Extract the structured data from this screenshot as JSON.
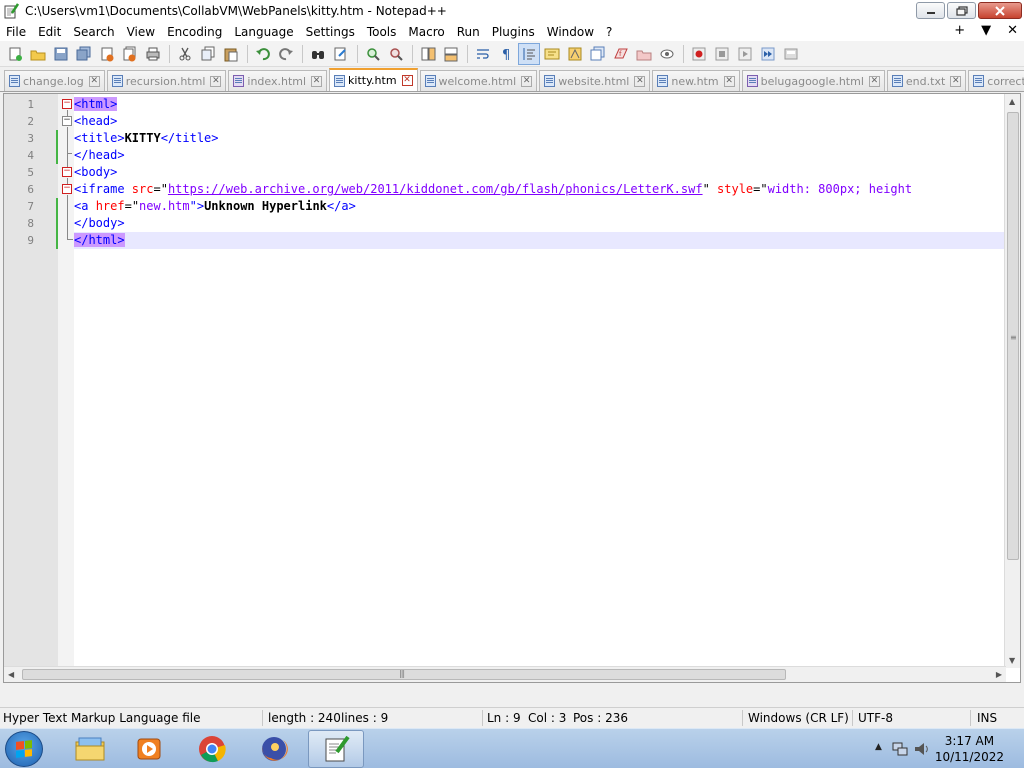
{
  "window": {
    "title": "C:\\Users\\vm1\\Documents\\CollabVM\\WebPanels\\kitty.htm - Notepad++",
    "minimize": "▁",
    "maximize": "❐",
    "close": "✕"
  },
  "menu": {
    "items": [
      "File",
      "Edit",
      "Search",
      "View",
      "Encoding",
      "Language",
      "Settings",
      "Tools",
      "Macro",
      "Run",
      "Plugins",
      "Window",
      "?"
    ],
    "right": [
      "+",
      "▼",
      "✕"
    ]
  },
  "toolbar": {
    "icons": [
      "new-file-icon",
      "open-file-icon",
      "save-icon",
      "save-all-icon",
      "close-icon",
      "close-all-icon",
      "print-icon",
      "cut-icon",
      "copy-icon",
      "paste-icon",
      "undo-icon",
      "redo-icon",
      "find-icon",
      "replace-icon",
      "zoom-in-icon",
      "zoom-out-icon",
      "sync-v-icon",
      "sync-h-icon",
      "word-wrap-icon",
      "show-all-chars-icon",
      "indent-guide-icon",
      "udl-icon",
      "doc-map-icon",
      "function-list-icon",
      "folder-workspace-icon",
      "monitor-icon",
      "record-macro-icon",
      "stop-macro-icon",
      "play-macro-icon",
      "play-multiple-icon",
      "save-macro-icon"
    ]
  },
  "tabs": [
    {
      "label": "change.log",
      "active": false
    },
    {
      "label": "recursion.html",
      "active": false
    },
    {
      "label": "index.html",
      "active": false
    },
    {
      "label": "kitty.htm",
      "active": true
    },
    {
      "label": "welcome.html",
      "active": false
    },
    {
      "label": "website.html",
      "active": false
    },
    {
      "label": "new.htm",
      "active": false
    },
    {
      "label": "belugagoogle.html",
      "active": false
    },
    {
      "label": "end.txt",
      "active": false
    },
    {
      "label": "correct.html",
      "active": false
    }
  ],
  "editor": {
    "line_numbers": [
      "1",
      "2",
      "3",
      "4",
      "5",
      "6",
      "7",
      "8",
      "9"
    ],
    "current_line": 9,
    "code": {
      "l1_tag": "<html>",
      "l2_tag": "<head>",
      "l3_open": "<title>",
      "l3_text": "KITTY",
      "l3_close": "</title>",
      "l4_tag": "</head>",
      "l5_tag": "<body>",
      "l6_open": "<iframe ",
      "l6_attr1": "src",
      "l6_eq1": "=\"",
      "l6_url": "https://web.archive.org/web/2011/kiddonet.com/gb/flash/phonics/LetterK.swf",
      "l6_q1": "\" ",
      "l6_attr2": "style",
      "l6_eq2": "=\"",
      "l6_val2": "width: 800px; height",
      "l7_open": "<a ",
      "l7_attr": "href",
      "l7_eq": "=\"",
      "l7_val": "new.htm",
      "l7_close": "\">",
      "l7_text": "Unknown Hyperlink",
      "l7_end": "</a>",
      "l8_tag": "</body>",
      "l9_tag": "</html>"
    }
  },
  "status": {
    "file_type": "Hyper Text Markup Language file",
    "length": "length : 240",
    "lines": "lines : 9",
    "ln": "Ln : 9",
    "col": "Col : 3",
    "pos": "Pos : 236",
    "eol": "Windows (CR LF)",
    "encoding": "UTF-8",
    "mode": "INS"
  },
  "taskbar": {
    "apps": [
      "explorer-icon",
      "media-player-icon",
      "chrome-icon",
      "firefox-icon",
      "notepadpp-icon"
    ],
    "time": "3:17 AM",
    "date": "10/11/2022"
  }
}
